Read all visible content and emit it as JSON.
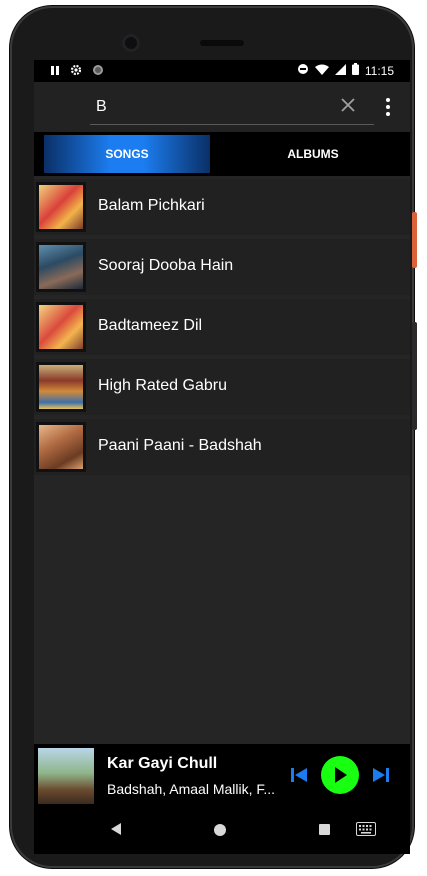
{
  "status_bar": {
    "time": "11:15",
    "left_icons": [
      "pause-icon",
      "settings-icon",
      "circle-icon"
    ],
    "right_icons": [
      "do-not-disturb-icon",
      "wifi-icon",
      "signal-icon",
      "battery-icon"
    ]
  },
  "search": {
    "value": "B",
    "clear_icon": "close-icon",
    "menu_icon": "more-vert-icon"
  },
  "tabs": [
    {
      "label": "SONGS",
      "active": true
    },
    {
      "label": "ALBUMS",
      "active": false
    }
  ],
  "songs": [
    {
      "title": "Balam Pichkari"
    },
    {
      "title": "Sooraj Dooba Hain"
    },
    {
      "title": "Badtameez Dil"
    },
    {
      "title": "High Rated Gabru"
    },
    {
      "title": "Paani Paani - Badshah"
    }
  ],
  "now_playing": {
    "title": "Kar Gayi Chull",
    "artist": "Badshah, Amaal Mallik, F..."
  },
  "colors": {
    "accent_blue": "#1c7df0",
    "play_green": "#19ff12",
    "background": "#252525"
  },
  "nav_icons": [
    "back-icon",
    "home-icon",
    "recents-icon",
    "keyboard-icon"
  ]
}
